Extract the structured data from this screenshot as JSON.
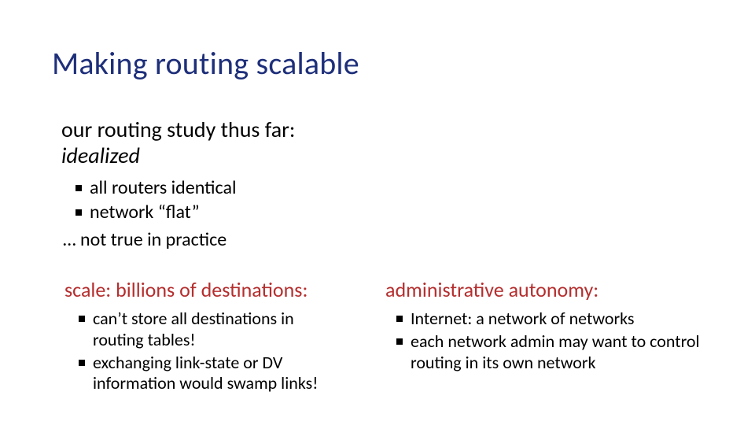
{
  "title": "Making routing scalable",
  "intro": {
    "line1": "our routing study thus far:",
    "line2": "idealized"
  },
  "top_bullets": [
    "all routers identical",
    "network “flat”"
  ],
  "not_true": "… not true in practice",
  "left": {
    "heading": "scale: billions of destinations:",
    "bullets": [
      "can’t store all destinations in routing tables!",
      "exchanging  link-state or DV information  would swamp links!"
    ]
  },
  "right": {
    "heading": "administrative autonomy:",
    "bullets": [
      "Internet: a network of networks",
      "each network admin may want to control routing in its own network"
    ]
  }
}
